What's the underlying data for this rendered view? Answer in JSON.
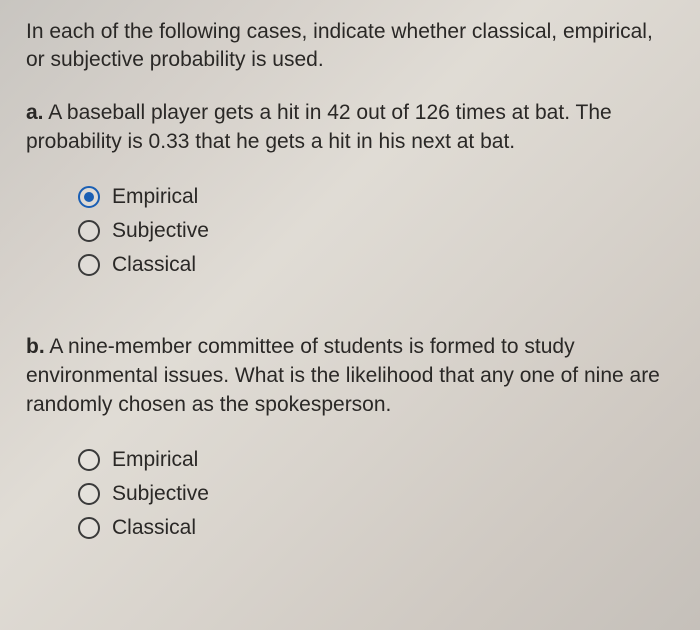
{
  "intro": "In each of the following cases, indicate whether classical, empirical, or subjective probability is used.",
  "questions": [
    {
      "label": "a.",
      "text": "A baseball player gets a hit in 42 out of 126 times at bat. The probability is 0.33 that he gets a hit in his next at bat.",
      "options": [
        {
          "label": "Empirical",
          "selected": true
        },
        {
          "label": "Subjective",
          "selected": false
        },
        {
          "label": "Classical",
          "selected": false
        }
      ]
    },
    {
      "label": "b.",
      "text": "A nine-member committee of students is formed to study environmental issues. What is the likelihood that any one of nine are randomly chosen as the spokesperson.",
      "options": [
        {
          "label": "Empirical",
          "selected": false
        },
        {
          "label": "Subjective",
          "selected": false
        },
        {
          "label": "Classical",
          "selected": false
        }
      ]
    }
  ]
}
